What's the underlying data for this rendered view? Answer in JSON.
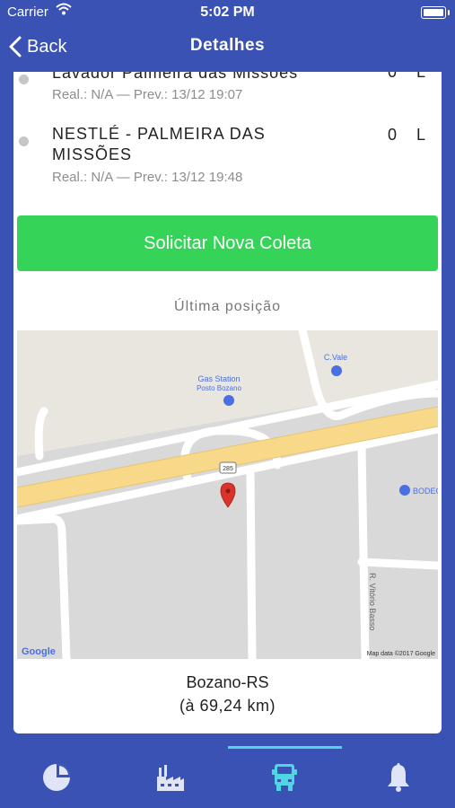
{
  "status_bar": {
    "carrier": "Carrier",
    "time": "5:02 PM"
  },
  "nav": {
    "back_label": "Back",
    "title": "Detalhes"
  },
  "stops": [
    {
      "name": "Lavador Palmeira das Missões",
      "quantity": "0",
      "unit": "L",
      "times": "Real.: N/A — Prev.: 13/12 19:07"
    },
    {
      "name": "NESTLÉ - PALMEIRA DAS MISSÕES",
      "quantity": "0",
      "unit": "L",
      "times": "Real.: N/A — Prev.: 13/12 19:48"
    }
  ],
  "request_button": "Solicitar Nova Coleta",
  "last_position_label": "Última posição",
  "map": {
    "labels": {
      "gas_station_1": "Gas Station",
      "gas_station_2": "Posto Bozano",
      "cvale": "C.Vale",
      "bodega": "BODEG",
      "street": "R. Vitório Basso",
      "road_shield": "285",
      "google": "Google",
      "attribution": "Map data ©2017 Google"
    },
    "colors": {
      "land": "#e9e6df",
      "block": "#d9d9d9",
      "road": "#ffffff",
      "highway": "#f8d98a",
      "pin": "#d9342b",
      "poi": "#4a6fe3"
    }
  },
  "location": {
    "name": "Bozano-RS",
    "distance": "(à 69,24 km)"
  },
  "tabs": [
    {
      "id": "dashboard",
      "icon": "pie-chart-icon",
      "active": false
    },
    {
      "id": "factory",
      "icon": "factory-icon",
      "active": false
    },
    {
      "id": "truck",
      "icon": "truck-icon",
      "active": true
    },
    {
      "id": "notifications",
      "icon": "bell-icon",
      "active": false
    }
  ],
  "theme": {
    "primary": "#3a52b3",
    "accent": "#35d458",
    "tab_active": "#4fd5e3"
  }
}
